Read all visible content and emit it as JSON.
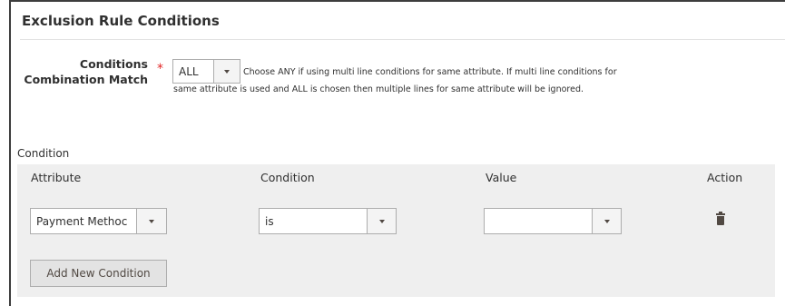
{
  "section": {
    "title": "Exclusion Rule Conditions"
  },
  "combination_match": {
    "label": "Conditions Combination Match",
    "required_marker": "*",
    "selected": "ALL",
    "note": "Choose ANY if using multi line conditions for same attribute. If multi line conditions for same attribute is used and ALL is chosen then multiple lines for same attribute will be ignored."
  },
  "conditions": {
    "heading": "Condition",
    "columns": [
      "Attribute",
      "Condition",
      "Value",
      "Action"
    ],
    "rows": [
      {
        "attribute": "Payment Methoc",
        "condition": "is",
        "value": "",
        "action_icon": "trash-icon"
      }
    ],
    "add_button_label": "Add New Condition"
  },
  "colors": {
    "required": "#e22626",
    "panel_bg": "#efefef",
    "button_bg": "#e3e3e3",
    "text": "#303030"
  }
}
